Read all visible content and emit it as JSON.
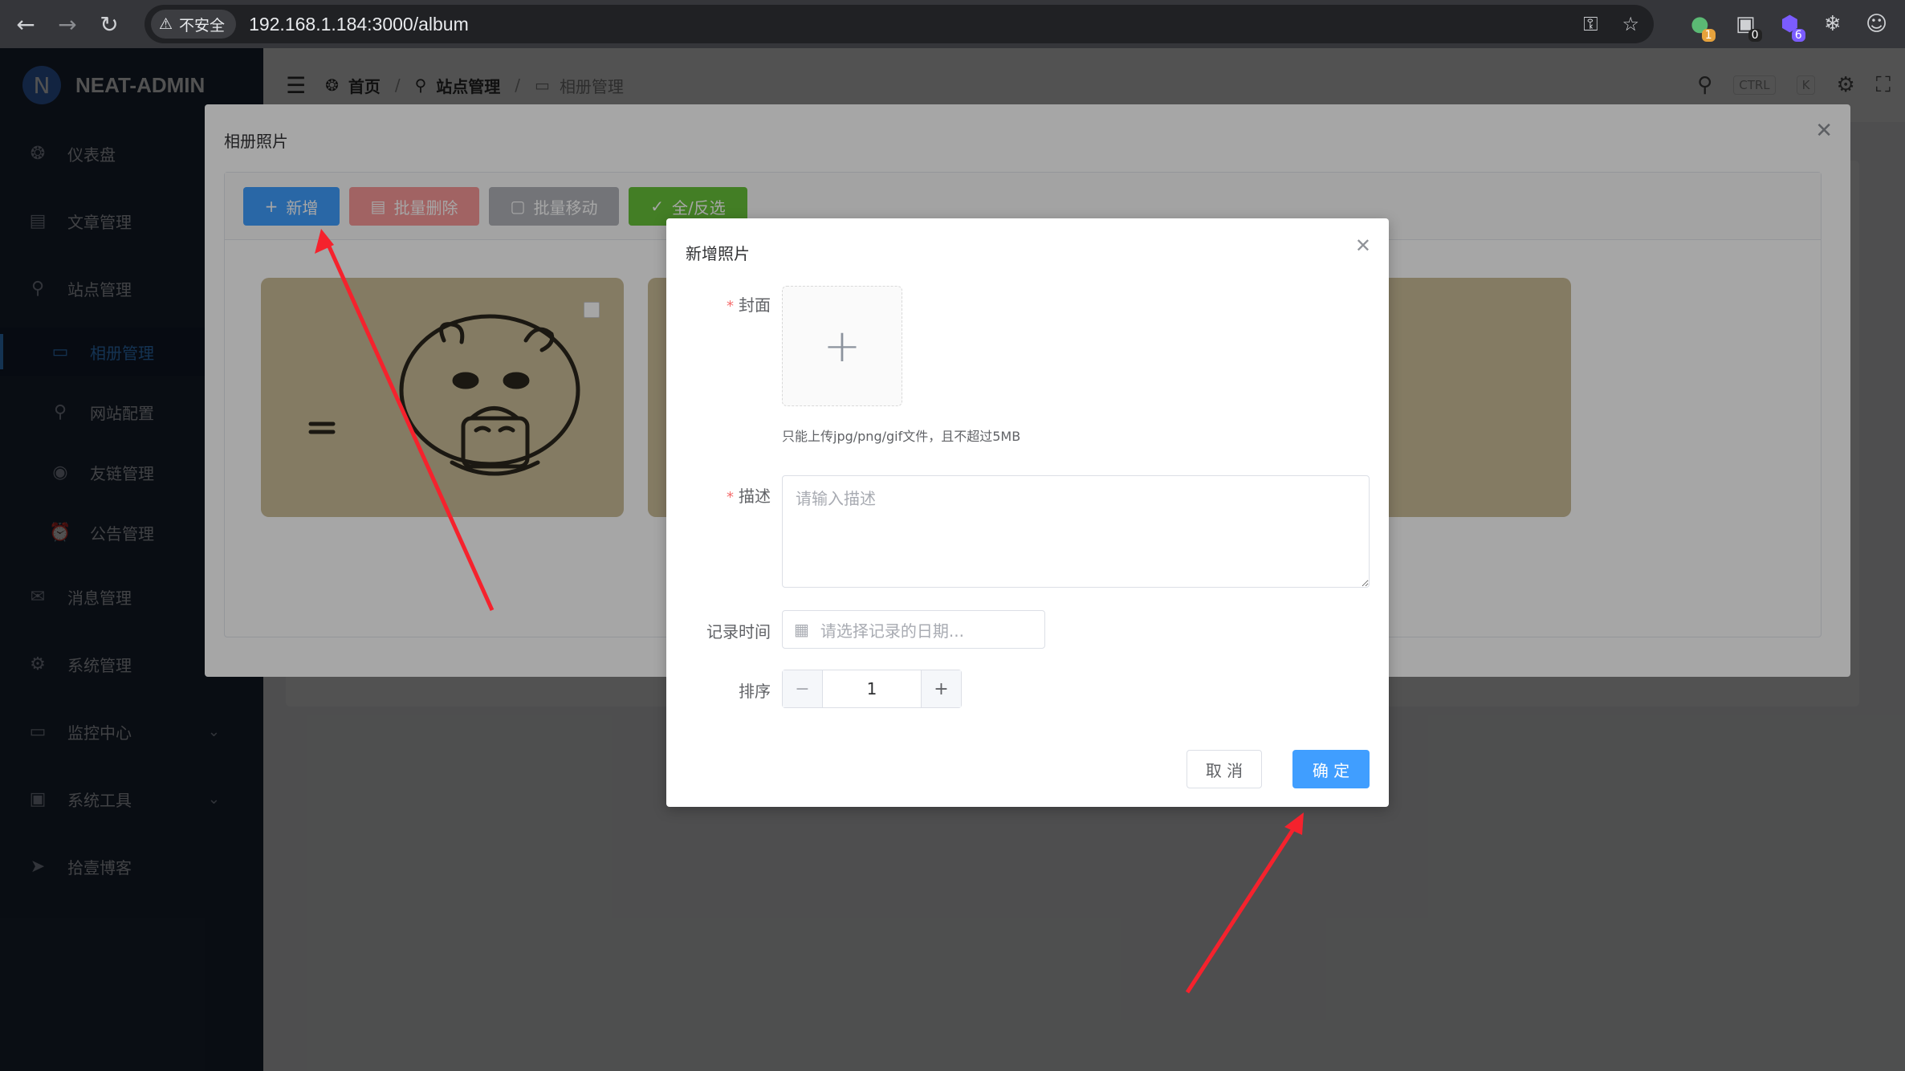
{
  "browser": {
    "security_label": "不安全",
    "url": "192.168.1.184:3000/album",
    "ext_badges": [
      "1",
      "0",
      "6"
    ]
  },
  "app": {
    "brand": "NEAT-ADMIN",
    "brand_letter": "N",
    "sidebar": [
      {
        "label": "仪表盘",
        "icon": "dashboard-icon"
      },
      {
        "label": "文章管理",
        "icon": "document-icon"
      },
      {
        "label": "站点管理",
        "icon": "location-icon"
      },
      {
        "label": "相册管理",
        "icon": "album-icon"
      },
      {
        "label": "网站配置",
        "icon": "location-icon"
      },
      {
        "label": "友链管理",
        "icon": "chrome-icon"
      },
      {
        "label": "公告管理",
        "icon": "alarm-icon"
      },
      {
        "label": "消息管理",
        "icon": "message-icon"
      },
      {
        "label": "系统管理",
        "icon": "gear-icon"
      },
      {
        "label": "监控中心",
        "icon": "monitor-icon"
      },
      {
        "label": "系统工具",
        "icon": "toolbox-icon"
      },
      {
        "label": "拾壹博客",
        "icon": "navigation-icon"
      }
    ],
    "breadcrumb": [
      "首页",
      "站点管理",
      "相册管理"
    ],
    "search_kbd": [
      "CTRL",
      "K"
    ]
  },
  "album_dialog": {
    "title": "相册照片",
    "toolbar": {
      "add": "新增",
      "batch_delete": "批量删除",
      "batch_move": "批量移动",
      "select_all": "全/反选"
    },
    "colors": {
      "primary": "#409eff",
      "danger": "#f56c6c",
      "info": "#909399",
      "success": "#67c23a"
    }
  },
  "new_photo_dialog": {
    "title": "新增照片",
    "cover_label": "封面",
    "upload_tip": "只能上传jpg/png/gif文件，且不超过5MB",
    "desc_label": "描述",
    "desc_placeholder": "请输入描述",
    "date_label": "记录时间",
    "date_placeholder": "请选择记录的日期...",
    "order_label": "排序",
    "order_value": "1",
    "cancel": "取 消",
    "confirm": "确 定"
  }
}
